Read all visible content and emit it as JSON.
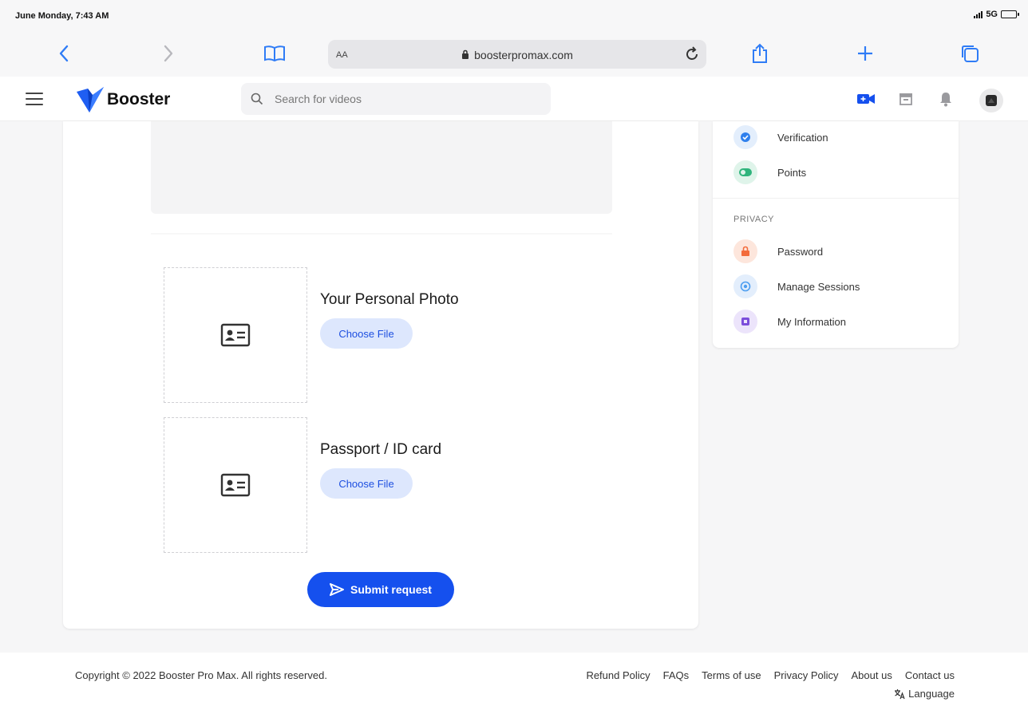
{
  "status_bar": {
    "time": "June Monday, 7:43 AM",
    "network": "5G"
  },
  "browser": {
    "text_size_label": "AA",
    "url": "boosterpromax.com"
  },
  "header": {
    "logo_text": "Booster",
    "search_placeholder": "Search for videos",
    "search_value": ""
  },
  "sidebar": {
    "items_top": [
      {
        "label": "Verification",
        "icon": "verified-check-icon",
        "color": "#2f80ed",
        "bg": "#e3eefc"
      },
      {
        "label": "Points",
        "icon": "points-toggle-icon",
        "color": "#2fb47c",
        "bg": "#dff4ea"
      }
    ],
    "privacy_title": "PRIVACY",
    "items_privacy": [
      {
        "label": "Password",
        "icon": "lock-icon",
        "color": "#f36b3b",
        "bg": "#fde6dc"
      },
      {
        "label": "Manage Sessions",
        "icon": "sessions-icon",
        "color": "#4d9ef0",
        "bg": "#e3eefc"
      },
      {
        "label": "My Information",
        "icon": "info-card-icon",
        "color": "#7c4ddb",
        "bg": "#ece4fb"
      }
    ]
  },
  "uploads": [
    {
      "title": "Your Personal Photo",
      "button_label": "Choose File"
    },
    {
      "title": "Passport / ID card",
      "button_label": "Choose File"
    }
  ],
  "submit_label": "Submit request",
  "footer": {
    "copyright": "Copyright © 2022 Booster Pro Max. All rights reserved.",
    "links": [
      "Refund Policy",
      "FAQs",
      "Terms of use",
      "Privacy Policy",
      "About us",
      "Contact us"
    ],
    "language_label": "Language"
  },
  "colors": {
    "accent": "#1550ee",
    "choose_file_bg": "#dde7fd",
    "choose_file_text": "#1d4fe0",
    "safari_blue": "#2f7cf6"
  }
}
